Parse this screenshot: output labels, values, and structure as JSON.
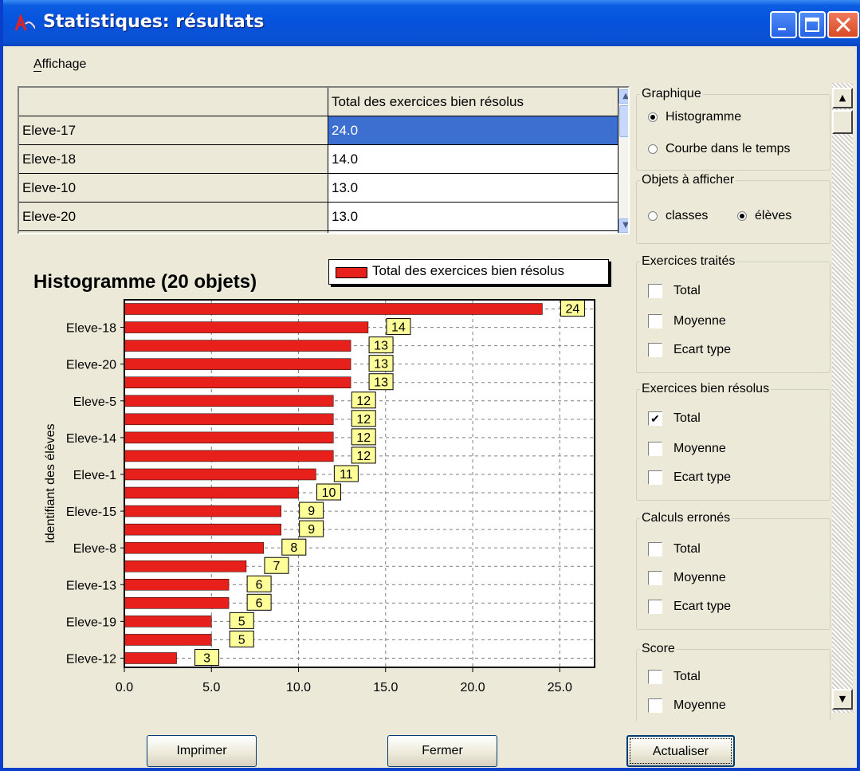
{
  "window": {
    "title": "Statistiques: résultats"
  },
  "menu": {
    "affichage": "Affichage"
  },
  "grid": {
    "header": "Total des exercices bien résolus",
    "rows": [
      {
        "name": "Eleve-17",
        "value": "24.0"
      },
      {
        "name": "Eleve-18",
        "value": "14.0"
      },
      {
        "name": "Eleve-10",
        "value": "13.0"
      },
      {
        "name": "Eleve-20",
        "value": "13.0"
      }
    ]
  },
  "chart_data": {
    "type": "bar",
    "orientation": "horizontal",
    "title": "Histogramme (20 objets)",
    "ylabel": "Identifiant des élèves",
    "xlabel": "",
    "legend": [
      "Total des exercices bien résolus"
    ],
    "legend_position": "top-right",
    "xlim": [
      0,
      27
    ],
    "xticks": [
      "0.0",
      "5.0",
      "10.0",
      "15.0",
      "20.0",
      "25.0"
    ],
    "grid": true,
    "bar_color": "#e8201c",
    "label_bg": "#ffff99",
    "categories": [
      "",
      "Eleve-18",
      "",
      "Eleve-20",
      "",
      "Eleve-5",
      "",
      "Eleve-14",
      "",
      "Eleve-1",
      "",
      "Eleve-15",
      "",
      "Eleve-8",
      "",
      "Eleve-13",
      "",
      "Eleve-19",
      "",
      "Eleve-12"
    ],
    "values": [
      24,
      14,
      13,
      13,
      13,
      12,
      12,
      12,
      12,
      11,
      10,
      9,
      9,
      8,
      7,
      6,
      6,
      5,
      5,
      3
    ],
    "series": [
      {
        "name": "Total des exercices bien résolus",
        "values": [
          24,
          14,
          13,
          13,
          13,
          12,
          12,
          12,
          12,
          11,
          10,
          9,
          9,
          8,
          7,
          6,
          6,
          5,
          5,
          3
        ]
      }
    ]
  },
  "panel": {
    "graphique": {
      "title": "Graphique",
      "histogramme": "Histogramme",
      "courbe": "Courbe dans le temps"
    },
    "objets": {
      "title": "Objets à afficher",
      "classes": "classes",
      "eleves": "élèves"
    },
    "traites": {
      "title": "Exercices traités",
      "total": "Total",
      "moyenne": "Moyenne",
      "ecart": "Ecart type"
    },
    "bien": {
      "title": "Exercices bien résolus",
      "total": "Total",
      "moyenne": "Moyenne",
      "ecart": "Ecart type"
    },
    "calculs": {
      "title": "Calculs erronés",
      "total": "Total",
      "moyenne": "Moyenne",
      "ecart": "Ecart type"
    },
    "score": {
      "title": "Score",
      "total": "Total",
      "moyenne": "Moyenne"
    },
    "check_mark": "✔"
  },
  "buttons": {
    "imprimer": "Imprimer",
    "fermer": "Fermer",
    "actualiser": "Actualiser"
  }
}
